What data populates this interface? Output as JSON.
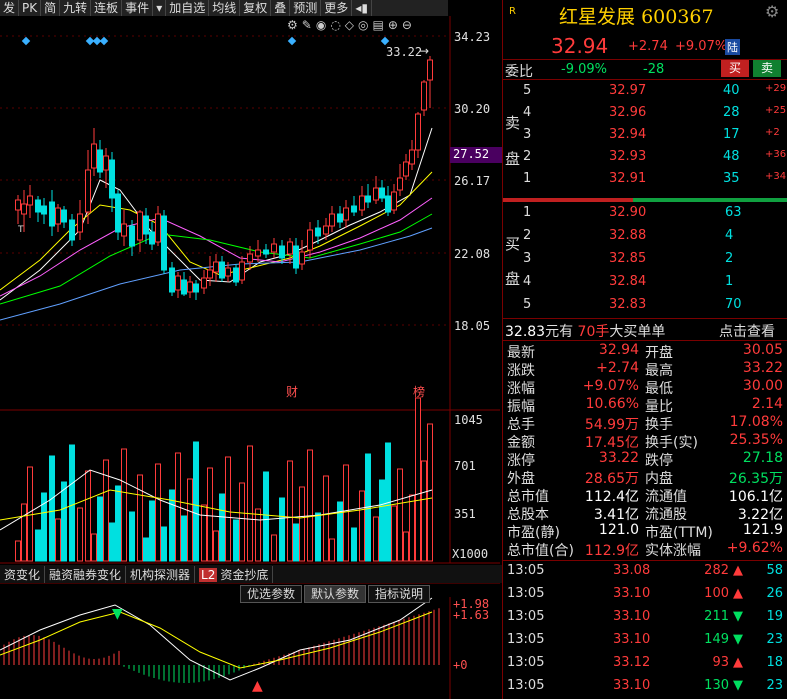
{
  "toolbar": {
    "items": [
      "发",
      "PK",
      "简",
      "九转",
      "连板",
      "事件",
      "加自选",
      "均线",
      "复权",
      "叠",
      "预测",
      "更多"
    ]
  },
  "price_axis": {
    "labels": [
      "34.23",
      "30.20",
      "26.17",
      "22.08",
      "18.05"
    ],
    "current": "27.52",
    "max_label": "33.22"
  },
  "volume_axis": {
    "labels": [
      "1045",
      "701",
      "351"
    ],
    "unit": "X1000"
  },
  "macd_axis": {
    "labels": [
      "+1.98",
      "+1.63",
      "+0"
    ]
  },
  "event_markers": {
    "cai": "财",
    "bang": "榜"
  },
  "bottom_tabs": [
    "资变化",
    "融资融券变化",
    "机构探测器",
    "资金抄底"
  ],
  "bottom_tab_badge": "L2",
  "param_buttons": [
    "优选参数",
    "默认参数",
    "指标说明"
  ],
  "stock": {
    "name": "红星发展",
    "code": "600367",
    "flag": "R",
    "price": "32.94",
    "change": "+2.74",
    "change_pct": "+9.07%",
    "badge": "陆"
  },
  "weibi": {
    "label": "委比",
    "pct": "-9.09%",
    "diff": "-28",
    "buy_btn": "买",
    "sell_btn": "卖"
  },
  "sell_label": [
    "卖",
    "盘"
  ],
  "buy_label": [
    "买",
    "盘"
  ],
  "asks": [
    {
      "lvl": "5",
      "price": "32.97",
      "vol": "40",
      "delta": "+29"
    },
    {
      "lvl": "4",
      "price": "32.96",
      "vol": "28",
      "delta": "+25"
    },
    {
      "lvl": "3",
      "price": "32.94",
      "vol": "17",
      "delta": "+2"
    },
    {
      "lvl": "2",
      "price": "32.93",
      "vol": "48",
      "delta": "+36"
    },
    {
      "lvl": "1",
      "price": "32.91",
      "vol": "35",
      "delta": "+34"
    }
  ],
  "bids": [
    {
      "lvl": "1",
      "price": "32.90",
      "vol": "63"
    },
    {
      "lvl": "2",
      "price": "32.88",
      "vol": "4"
    },
    {
      "lvl": "3",
      "price": "32.85",
      "vol": "2"
    },
    {
      "lvl": "4",
      "price": "32.84",
      "vol": "1"
    },
    {
      "lvl": "5",
      "price": "32.83",
      "vol": "70"
    }
  ],
  "big_order": {
    "price": "32.83",
    "unit": "元有",
    "hands": "70手",
    "label": "大买单单",
    "link": "点击查看"
  },
  "stats": [
    {
      "l1": "最新",
      "v1": "32.94",
      "l2": "开盘",
      "v2": "30.05"
    },
    {
      "l1": "涨跌",
      "v1": "+2.74",
      "l2": "最高",
      "v2": "33.22"
    },
    {
      "l1": "涨幅",
      "v1": "+9.07%",
      "l2": "最低",
      "v2": "30.00"
    },
    {
      "l1": "振幅",
      "v1": "10.66%",
      "l2": "量比",
      "v2": "2.14"
    },
    {
      "l1": "总手",
      "v1": "54.99万",
      "l2": "换手",
      "v2": "17.08%"
    },
    {
      "l1": "金额",
      "v1": "17.45亿",
      "l2": "换手(实)",
      "v2": "25.35%"
    },
    {
      "l1": "涨停",
      "v1": "33.22",
      "l2": "跌停",
      "v2": "27.18"
    },
    {
      "l1": "外盘",
      "v1": "28.65万",
      "l2": "内盘",
      "v2": "26.35万"
    },
    {
      "l1": "总市值",
      "v1": "112.4亿",
      "l2": "流通值",
      "v2": "106.1亿"
    },
    {
      "l1": "总股本",
      "v1": "3.41亿",
      "l2": "流通股",
      "v2": "3.22亿"
    },
    {
      "l1": "市盈(静)",
      "v1": "121.0",
      "l2": "市盈(TTM)",
      "v2": "121.9"
    },
    {
      "l1": "总市值(合)",
      "v1": "112.9亿",
      "l2": "实体涨幅",
      "v2": "+9.62%"
    }
  ],
  "ticks": [
    {
      "time": "13:05",
      "price": "33.08",
      "vol": "282",
      "dir": "up",
      "n": "58"
    },
    {
      "time": "13:05",
      "price": "33.10",
      "vol": "100",
      "dir": "up",
      "n": "26"
    },
    {
      "time": "13:05",
      "price": "33.10",
      "vol": "211",
      "dir": "down",
      "n": "19"
    },
    {
      "time": "13:05",
      "price": "33.10",
      "vol": "149",
      "dir": "down",
      "n": "23"
    },
    {
      "time": "13:05",
      "price": "33.12",
      "vol": "93",
      "dir": "up",
      "n": "18"
    },
    {
      "time": "13:05",
      "price": "33.10",
      "vol": "130",
      "dir": "down",
      "n": "23"
    }
  ],
  "colors": {
    "up": "#ff3b3b",
    "down": "#00e0e0",
    "accent": "#ffd000",
    "ma5": "#ffffff",
    "ma10": "#ffff00",
    "ma20": "#ff60ff",
    "ma30": "#00ff00",
    "ma60": "#60a0ff"
  }
}
